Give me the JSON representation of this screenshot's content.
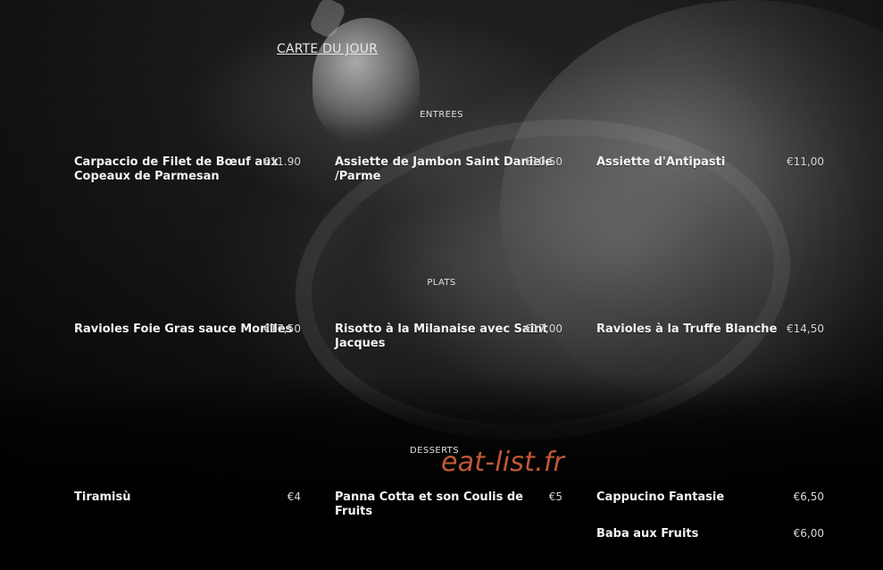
{
  "header": {
    "link_label": "CARTE DU JOUR"
  },
  "sections": {
    "entrees": {
      "title": "ENTREES",
      "items": [
        {
          "name": "Carpaccio de Filet de Bœuf aux Copeaux de Parmesan",
          "price": "€11.90"
        },
        {
          "name": "Assiette de Jambon Saint Daniele /Parme",
          "price": "€10,50"
        },
        {
          "name": "Assiette d'Antipasti",
          "price": "€11,00"
        }
      ]
    },
    "plats": {
      "title": "PLATS",
      "items": [
        {
          "name": "Ravioles Foie Gras sauce Morilles",
          "price": "€17,50"
        },
        {
          "name": "Risotto à la Milanaise avec Saint Jacques",
          "price": "€17,00"
        },
        {
          "name": "Ravioles à la Truffe Blanche",
          "price": "€14,50"
        }
      ]
    },
    "desserts": {
      "title": "DESSERTS",
      "items": [
        {
          "name": "Tiramisù",
          "price": "€4"
        },
        {
          "name": "Panna Cotta et son Coulis de Fruits",
          "price": "€5"
        },
        {
          "name": "Cappucino Fantasie",
          "price": "€6,50"
        },
        {
          "name": "Baba aux Fruits",
          "price": "€6,00"
        }
      ]
    }
  },
  "watermark": {
    "text": "eat-list.fr",
    "color": "#d25f3c"
  }
}
